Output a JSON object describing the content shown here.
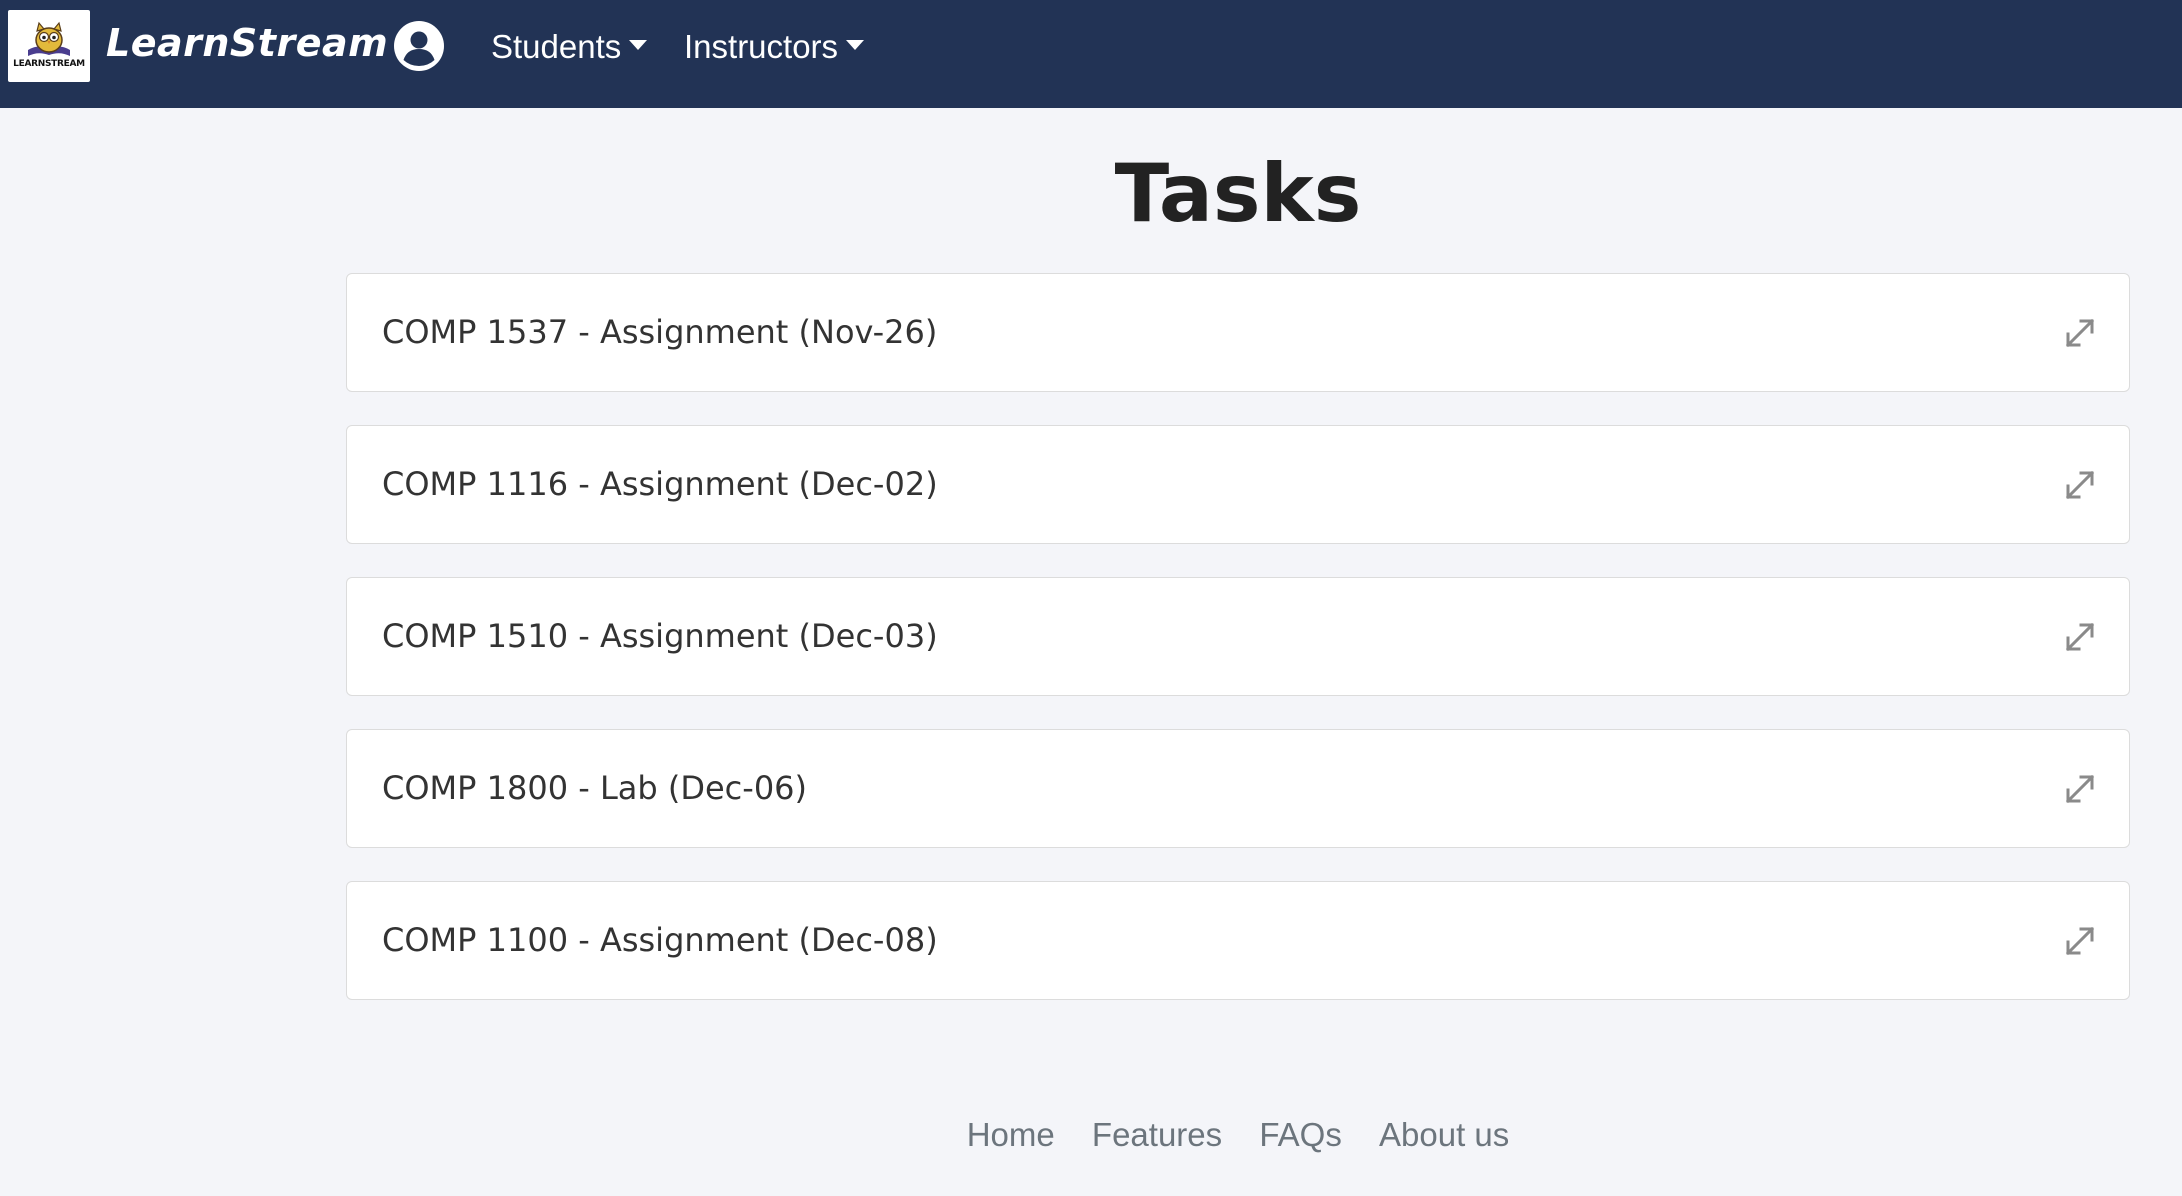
{
  "brand": {
    "logo_text": "LEARNSTREAM",
    "name": "LearnStream"
  },
  "navbar": {
    "user_icon": "user-circle-icon",
    "menus": [
      {
        "label": "Students"
      },
      {
        "label": "Instructors"
      }
    ],
    "colors": {
      "background": "#223355",
      "text": "#ffffff"
    }
  },
  "main": {
    "title": "Tasks",
    "tasks": [
      {
        "label": "COMP 1537 - Assignment (Nov-26)",
        "icon": "expand-icon"
      },
      {
        "label": "COMP 1116 - Assignment (Dec-02)",
        "icon": "expand-icon"
      },
      {
        "label": "COMP 1510 - Assignment (Dec-03)",
        "icon": "expand-icon"
      },
      {
        "label": "COMP 1800 - Lab (Dec-06)",
        "icon": "expand-icon"
      },
      {
        "label": "COMP 1100 - Assignment (Dec-08)",
        "icon": "expand-icon"
      }
    ]
  },
  "footer": {
    "links": [
      {
        "label": "Home"
      },
      {
        "label": "Features"
      },
      {
        "label": "FAQs"
      },
      {
        "label": "About us"
      }
    ]
  },
  "colors": {
    "page_background": "#f4f5f9",
    "card_background": "#ffffff",
    "footer_link": "#6c757d"
  }
}
